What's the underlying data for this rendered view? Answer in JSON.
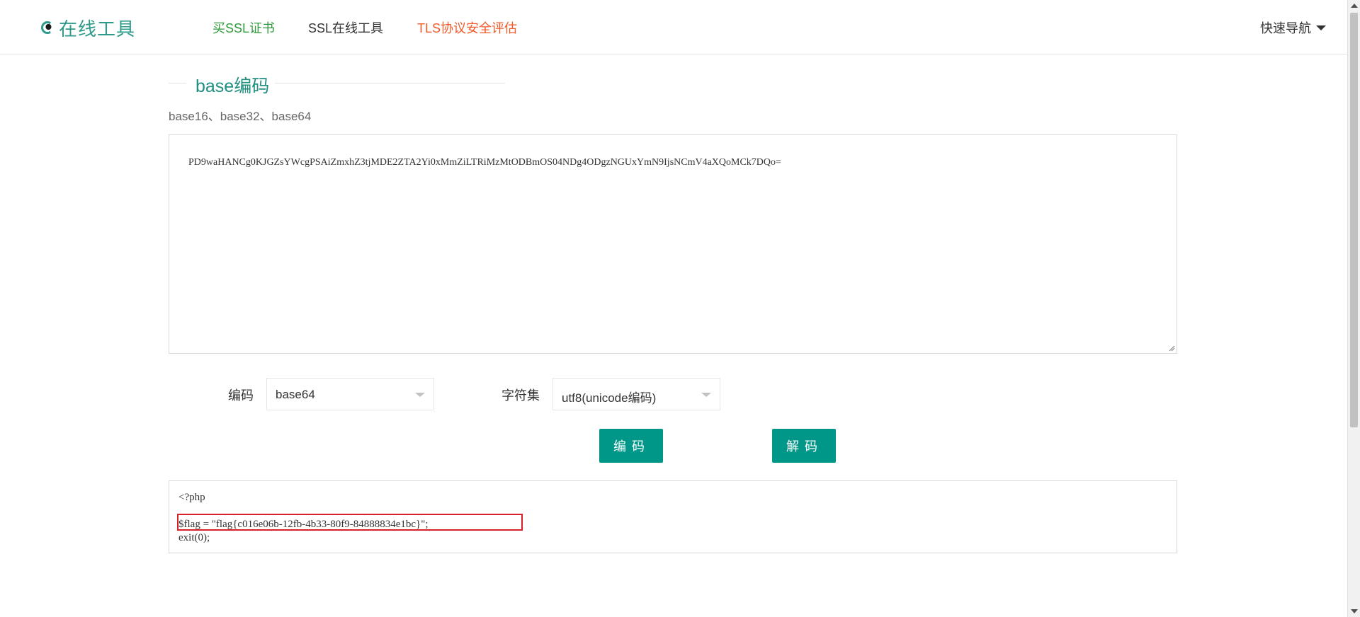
{
  "header": {
    "logo_text": "在线工具",
    "logo_icon": "eye-logo-icon",
    "nav": [
      {
        "label": "买SSL证书",
        "color": "#2f9a3a"
      },
      {
        "label": "SSL在线工具",
        "color": "#333333"
      },
      {
        "label": "TLS协议安全评估",
        "color": "#f05a28"
      }
    ],
    "quick_nav_label": "快速导航",
    "quick_nav_icon": "caret-down-icon"
  },
  "main": {
    "title": "base编码",
    "subtitle": "base16、base32、base64",
    "input_text": "PD9waHANCg0KJGZsYWcgPSAiZmxhZ3tjMDE2ZTA2Yi0xMmZiLTRiMzMtODBmOS04NDg4ODgzNGUxYmN9IjsNCmV4aXQoMCk7DQo=",
    "encoding_label": "编码",
    "encoding_value": "base64",
    "charset_label": "字符集",
    "charset_value": "utf8(unicode编码)",
    "encode_button": "编码",
    "decode_button": "解码",
    "output_lines": [
      "<?php",
      "$flag = \"flag{c016e06b-12fb-4b33-80f9-84888834e1bc}\";",
      "exit(0);"
    ],
    "accent_color": "#009688",
    "title_color": "#1f8f80",
    "highlight_color": "#d9202a"
  }
}
